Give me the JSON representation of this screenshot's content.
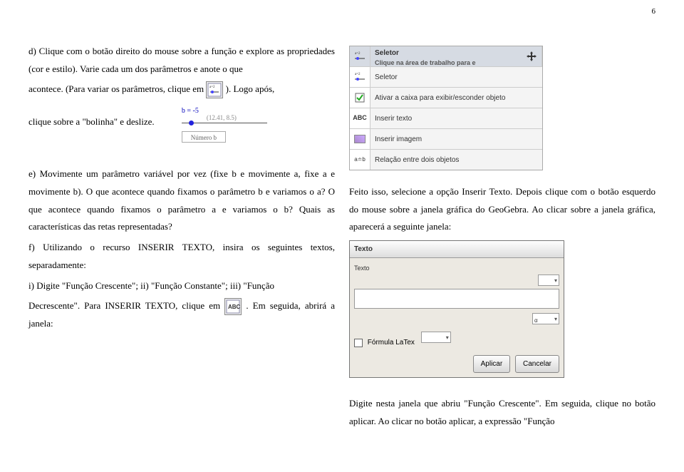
{
  "page_number": "6",
  "left": {
    "d": "d) Clique com o botão direito do mouse sobre a função e explore as propriedades (cor e estilo). Varie cada um dos parâmetros e anote o que",
    "acontece_pre": "acontece. (Para variar os parâmetros, clique em ",
    "acontece_post": "). Logo após,",
    "deslize": "clique sobre a \"bolinha\" e deslize. ",
    "e": "e) Movimente um parâmetro variável por vez (fixe b e movimente a, fixe a e movimente b). O que acontece quando fixamos o parâmetro b e variamos o a? O que acontece quando fixamos o parâmetro a e variamos o b? Quais as características das retas representadas?",
    "f": "f) Utilizando o recurso INSERIR TEXTO, insira os seguintes textos, separadamente:",
    "i": "i) Digite \"Função Crescente\"; ii) \"Função Constante\"; iii) \"Função",
    "decr_pre": "Decrescente\". Para INSERIR TEXTO, clique em ",
    "decr_post": ". Em seguida, abrirá a janela:"
  },
  "slider": {
    "b_label": "b = -5",
    "coords": "(12.41, 8.5)",
    "numbox": "Número b"
  },
  "toolbox": {
    "seletor_title": "Seletor",
    "seletor_sub": "Clique na área de trabalho para e",
    "row1": "Seletor",
    "row2": "Ativar a caixa para exibir/esconder objeto",
    "row3": "Inserir texto",
    "row4": "Inserir imagem",
    "row5": "Relação entre dois objetos",
    "icon_slider": "a=2",
    "icon_abc": "ABC",
    "icon_rel": "a≐b"
  },
  "right": {
    "feito": "Feito isso, selecione a opção Inserir Texto. Depois clique com o botão esquerdo do mouse sobre a janela gráfica do GeoGebra. Ao clicar sobre a janela gráfica, aparecerá a seguinte janela:",
    "digite": "Digite nesta janela que abriu \"Função Crescente\". Em seguida, clique no botão aplicar. Ao clicar no botão aplicar, a expressão \"Função"
  },
  "dialog": {
    "title": "Texto",
    "field_label": "Texto",
    "latex": "Fórmula LaTex",
    "apply": "Aplicar",
    "cancel": "Cancelar"
  }
}
